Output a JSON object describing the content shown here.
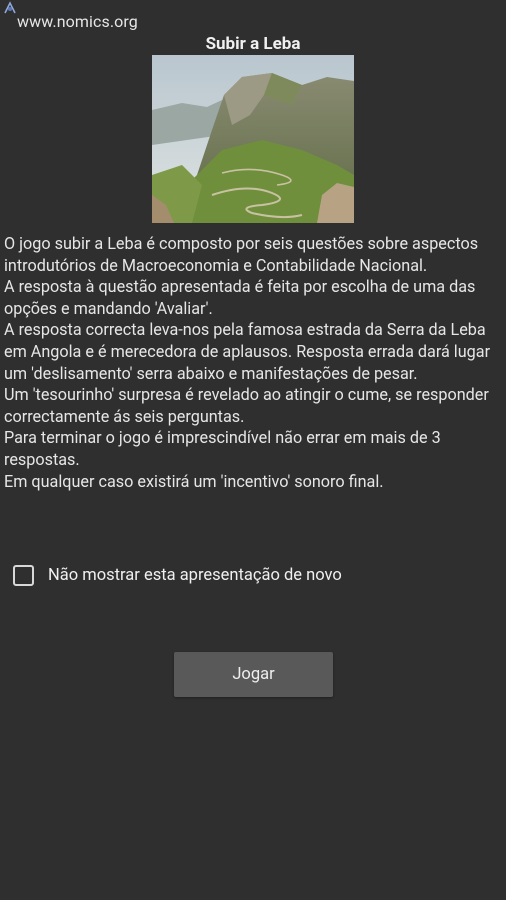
{
  "header": {
    "corner_icon": "app-launcher-icon",
    "site_url": "www.nomics.org"
  },
  "title": "Subir a Leba",
  "image": {
    "subject": "serra-da-leba-mountain-road-icon"
  },
  "description": {
    "paragraphs": [
      "O jogo subir a Leba é composto por seis questões sobre aspectos introdutórios de Macroeconomia e Contabilidade Nacional.",
      "A resposta à questão apresentada é feita por escolha de uma das opções e mandando 'Avaliar'.",
      "A resposta correcta leva-nos pela famosa estrada da Serra da Leba em Angola e é merecedora de aplausos. Resposta errada dará lugar um 'deslisamento' serra abaixo e manifestações de pesar.",
      "Um 'tesourinho' surpresa é revelado ao atingir o cume, se responder correctamente ás seis perguntas.",
      "Para terminar o jogo é imprescindível não errar em mais de 3 respostas.",
      "Em qualquer caso existirá um 'incentivo' sonoro final."
    ]
  },
  "checkbox": {
    "label": "Não mostrar esta apresentação de novo",
    "checked": false
  },
  "play_button": {
    "label": "Jogar"
  },
  "colors": {
    "background": "#2f2f2f",
    "text": "#e6e6e6",
    "button": "#595959"
  }
}
